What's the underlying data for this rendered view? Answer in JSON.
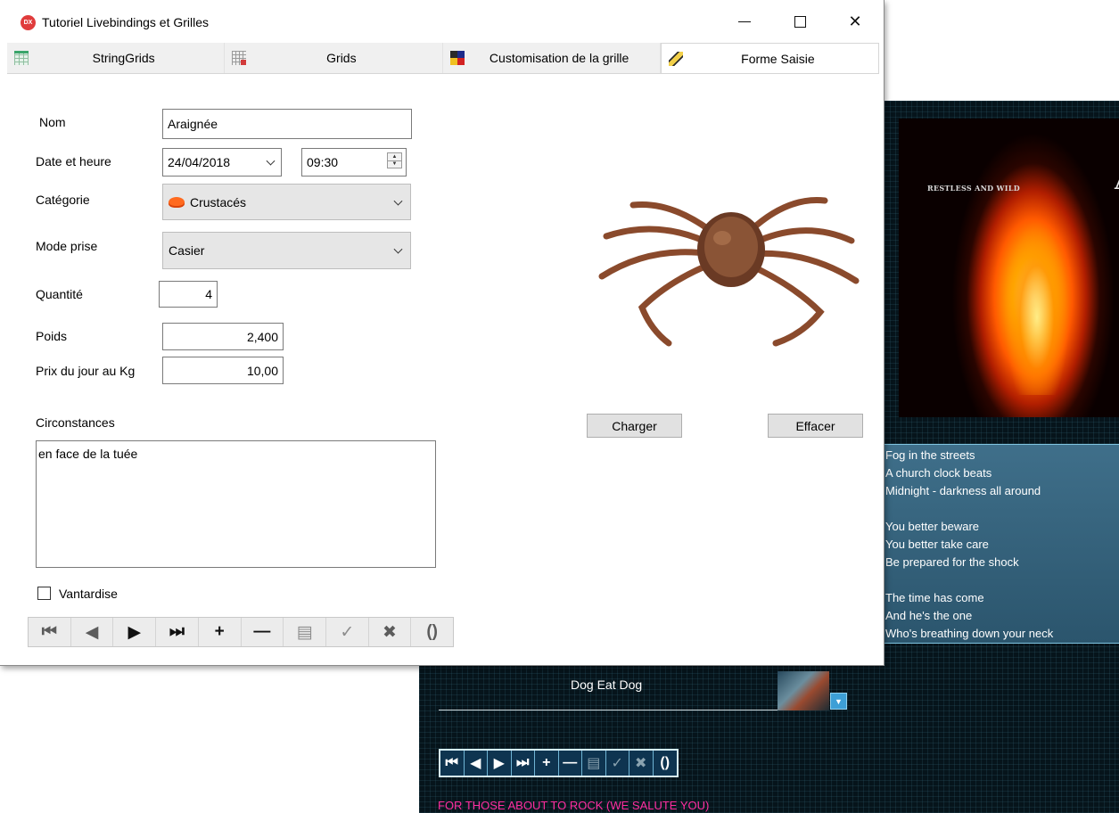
{
  "background_app": {
    "album_band": "RESTLESS AND WILD",
    "album_logo": "A",
    "lyrics": [
      [
        "Fog in the streets",
        "A church clock beats",
        "Midnight - darkness all around"
      ],
      [
        "You better beware",
        "You better take care",
        "Be prepared for the shock"
      ],
      [
        "The time has come",
        "And he's the one",
        "Who's breathing down your neck"
      ]
    ],
    "song_title": "Dog Eat Dog",
    "album_title": "FOR THOSE ABOUT TO ROCK (WE SALUTE YOU)",
    "colors": {
      "accent": "#3d9fd6",
      "title_pink": "#ff2ea0",
      "panel": "#3f6f8a"
    }
  },
  "window": {
    "icon_text": "DX",
    "title": "Tutoriel Livebindings et Grilles",
    "controls": {
      "minimize": "minimize",
      "maximize": "maximize",
      "close": "✕"
    }
  },
  "tabs": [
    {
      "label": "StringGrids",
      "icon": "stringgrid-icon",
      "active": false
    },
    {
      "label": "Grids",
      "icon": "grid-icon",
      "active": false
    },
    {
      "label": "Customisation de la grille",
      "icon": "customization-icon",
      "active": false
    },
    {
      "label": "Forme Saisie",
      "icon": "pencil-icon",
      "active": true
    }
  ],
  "form": {
    "nom_label": "Nom",
    "nom_value": "Araignée",
    "date_label": "Date et heure",
    "date_value": "24/04/2018",
    "time_value": "09:30",
    "categorie_label": "Catégorie",
    "categorie_value": "Crustacés",
    "mode_label": "Mode prise",
    "mode_value": "Casier",
    "quantite_label": "Quantité",
    "quantite_value": "4",
    "poids_label": "Poids",
    "poids_value": "2,400",
    "prix_label": "Prix du jour au Kg",
    "prix_value": "10,00",
    "circonstances_label": "Circonstances",
    "circonstances_value": "en face de la tuée",
    "vantardise_label": "Vantardise",
    "vantardise_checked": false
  },
  "image_buttons": {
    "load": "Charger",
    "clear": "Effacer"
  },
  "navigator_glyphs": {
    "first": "⏮",
    "prior": "◀",
    "next": "▶",
    "last": "⏭",
    "insert": "+",
    "delete": "—",
    "edit": "▤",
    "post": "✓",
    "cancel": "✖",
    "refresh": "()"
  }
}
